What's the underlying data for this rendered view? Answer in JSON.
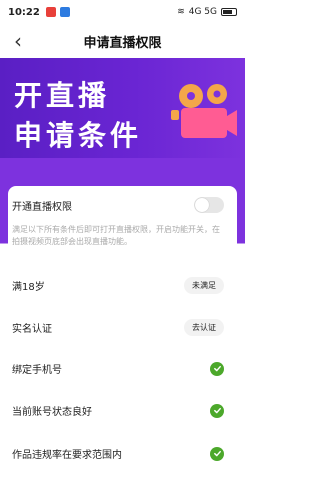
{
  "status": {
    "time": "10:22",
    "right_text": "4G 5G"
  },
  "nav": {
    "title": "申请直播权限",
    "back_glyph": "‹"
  },
  "banner": {
    "line1": "开直播",
    "line2": "申请条件"
  },
  "card": {
    "toggle_label": "开通直播权限",
    "toggle_on": false,
    "description": "满足以下所有条件后即可打开直播权限，开启功能开关，在拍摄视频页底部会出现直播功能。",
    "requirements": [
      {
        "label": "满18岁",
        "status": "未满足"
      },
      {
        "label": "实名认证",
        "status": "去认证"
      },
      {
        "label": "绑定手机号",
        "status": "check"
      },
      {
        "label": "当前账号状态良好",
        "status": "check"
      },
      {
        "label": "作品违规率在要求范围内",
        "status": "check"
      }
    ]
  },
  "colors": {
    "banner": "#6a25d3",
    "check": "#4ca82b"
  }
}
